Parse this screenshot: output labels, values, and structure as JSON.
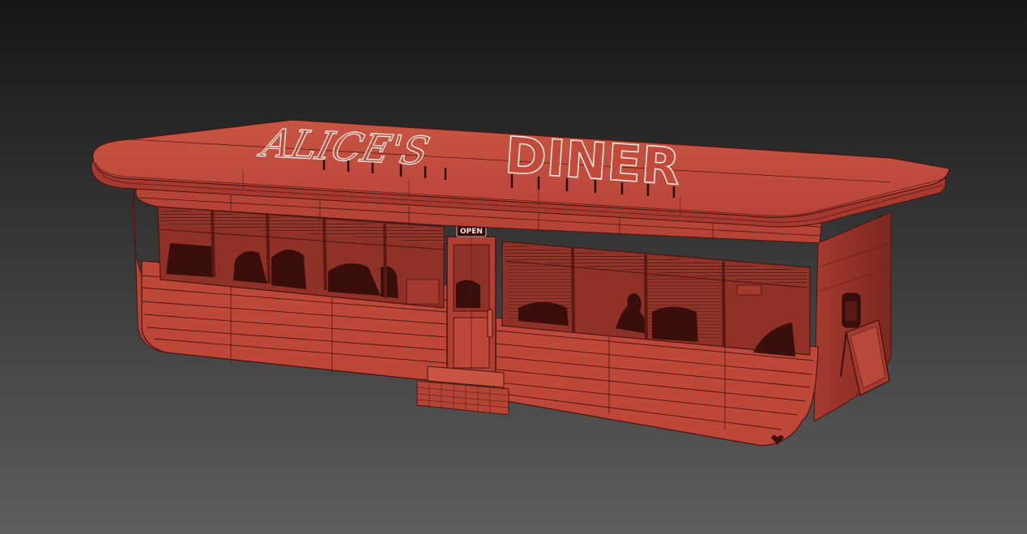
{
  "scene": {
    "description_label": "",
    "colors": {
      "background_top": "#161616",
      "background_bottom": "#5e5e5e",
      "model_base": "#c2493a",
      "model_shadow": "#8f3127",
      "model_dark": "#6e2219",
      "wire": "#4a1410",
      "interior": "#3a0e0a",
      "sign_fill": "#c24a3a",
      "sign_outline": "#f2e6df"
    }
  },
  "signage": {
    "name_word": "ALICE'S",
    "type_word": "DINER",
    "door_sign": "OPEN"
  }
}
